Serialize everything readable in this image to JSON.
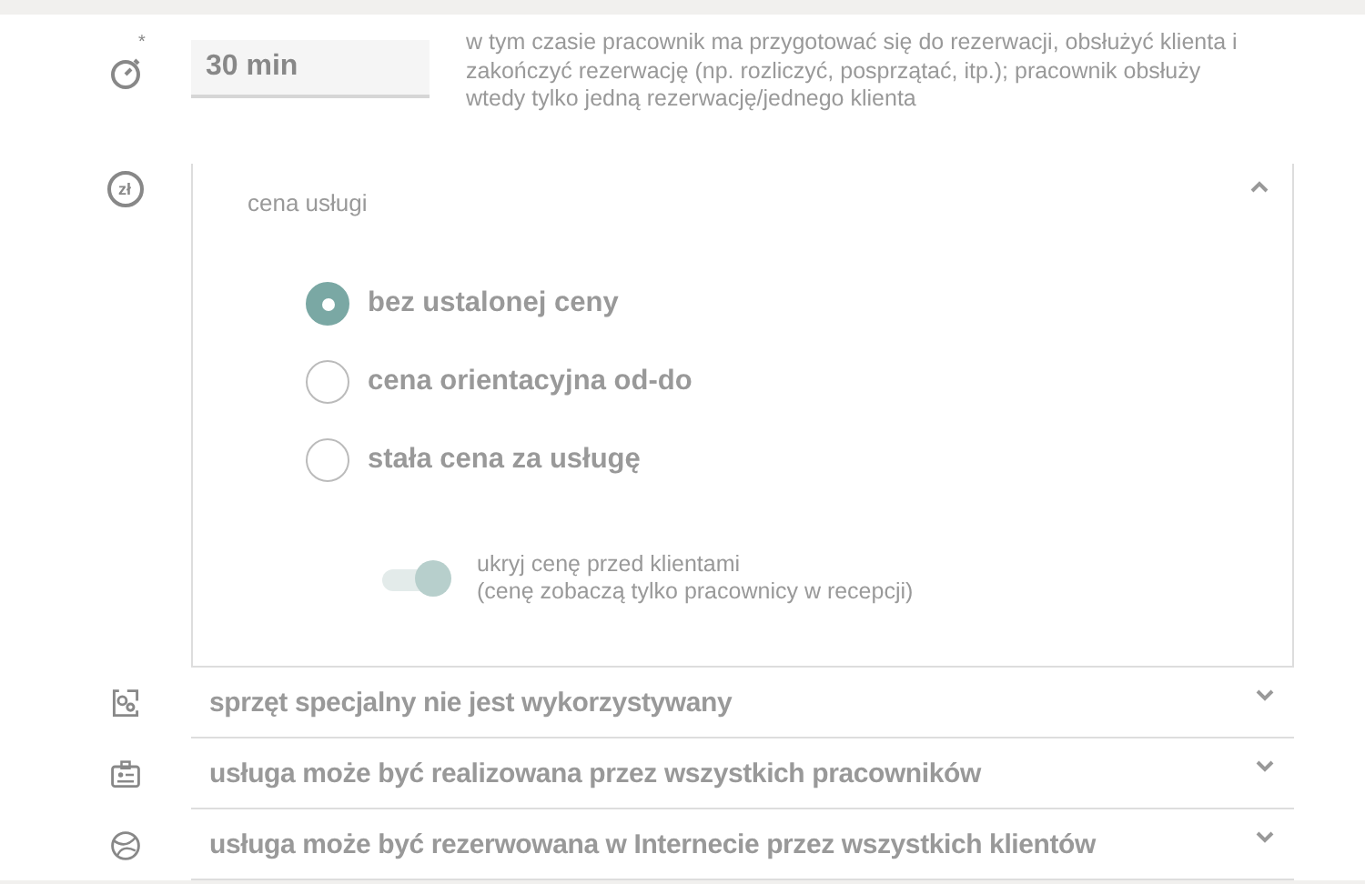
{
  "duration": {
    "required_mark": "*",
    "value": "30 min",
    "description": "w tym czasie pracownik ma przygotować się do rezerwacji, obsłużyć klienta i zakończyć rezerwację (np. rozliczyć, posprzątać, itp.); pracownik obsłuży wtedy tylko jedną rezerwację/jednego klienta"
  },
  "price": {
    "icon_text": "zł",
    "expanded": true,
    "title": "cena usługi",
    "options": [
      {
        "label": "bez ustalonej ceny",
        "selected": true
      },
      {
        "label": "cena orientacyjna od-do",
        "selected": false
      },
      {
        "label": "stała cena za usługę",
        "selected": false
      }
    ],
    "hide_toggle": {
      "on": true,
      "label": "ukryj cenę przed klientami",
      "note": "(cenę zobaczą tylko pracownicy w recepcji)"
    }
  },
  "sections": [
    {
      "kind": "equipment",
      "label": "sprzęt specjalny nie jest wykorzystywany",
      "expanded": false
    },
    {
      "kind": "staff",
      "label": "usługa może być realizowana przez wszystkich pracowników",
      "expanded": false
    },
    {
      "kind": "online",
      "label": "usługa może być rezerwowana w Internecie przez wszystkich klientów",
      "expanded": false
    }
  ]
}
